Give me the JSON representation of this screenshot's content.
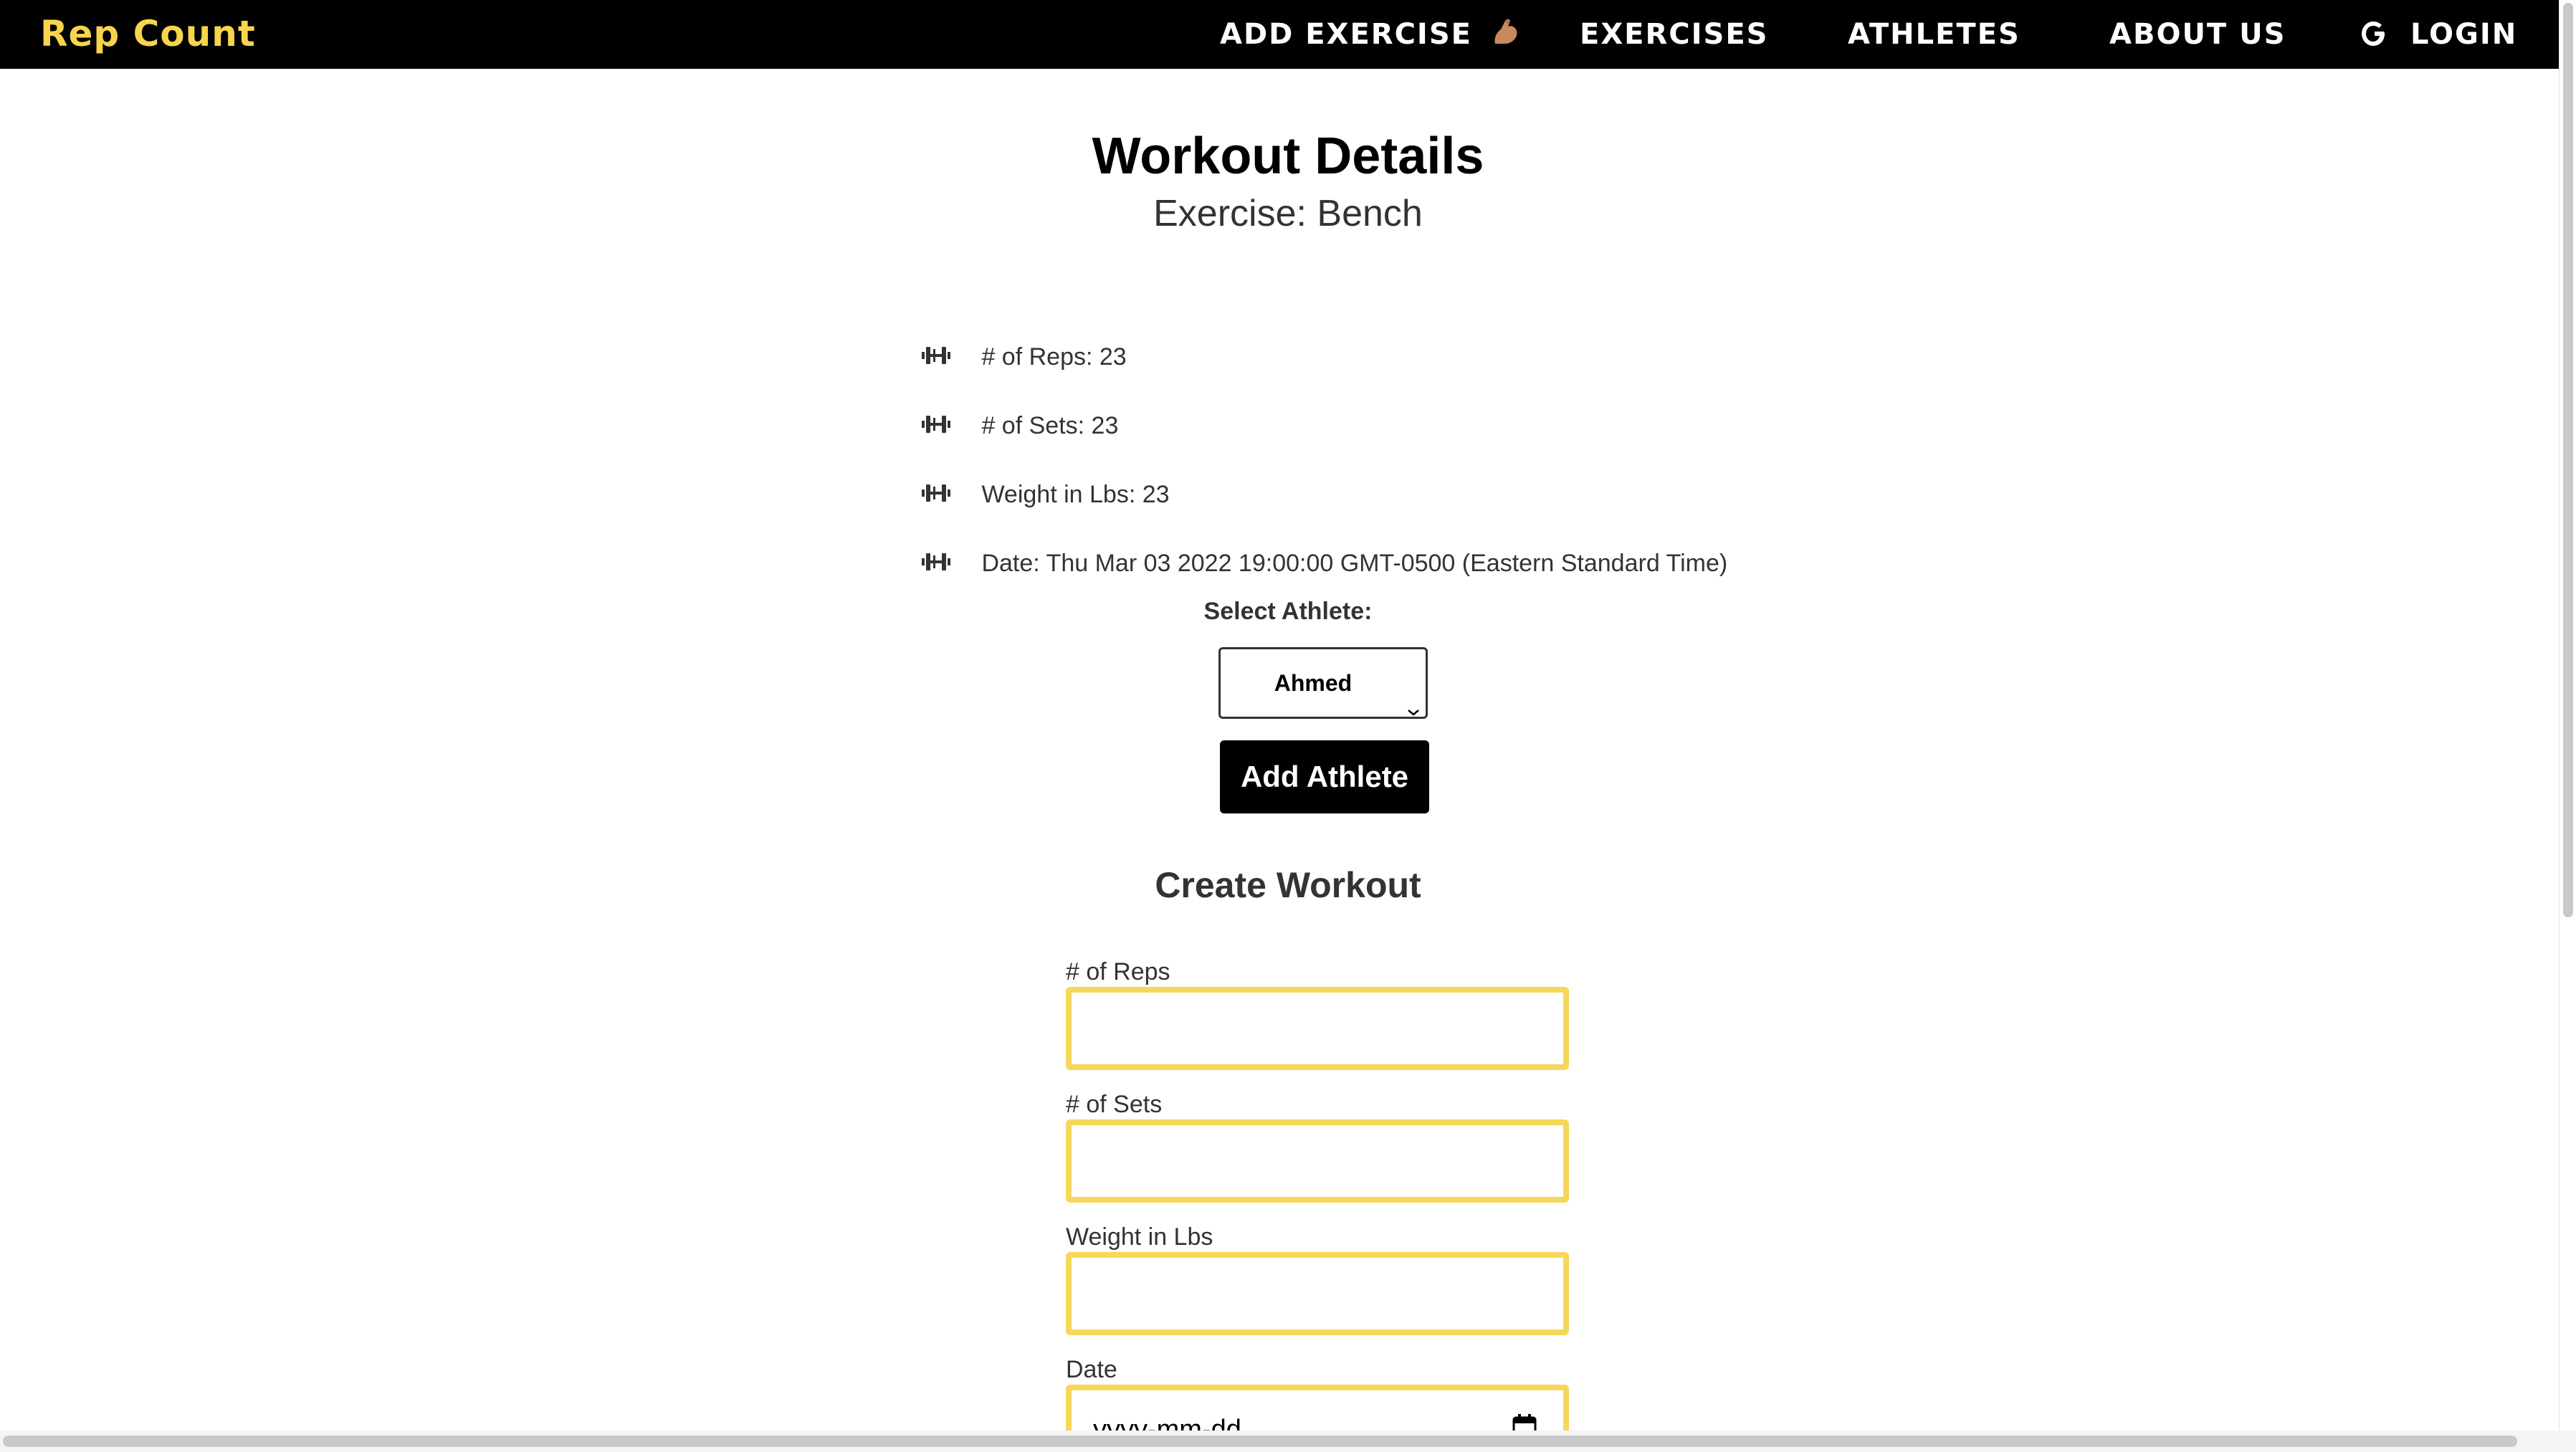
{
  "navbar": {
    "brand": "Rep Count",
    "items": [
      {
        "label": "ADD EXERCISE",
        "icon": "flexed-biceps-icon"
      },
      {
        "label": "EXERCISES"
      },
      {
        "label": "ATHLETES"
      },
      {
        "label": "ABOUT US"
      },
      {
        "label": "LOGIN",
        "icon": "google-icon"
      }
    ]
  },
  "workout": {
    "title": "Workout Details",
    "subtitle": "Exercise: Bench",
    "details": [
      "# of Reps: 23",
      "# of Sets: 23",
      "Weight in Lbs: 23",
      "Date: Thu Mar 03 2022 19:00:00 GMT-0500 (Eastern Standard Time)"
    ]
  },
  "athlete": {
    "label": "Select Athlete:",
    "selected": "Ahmed",
    "button": "Add Athlete"
  },
  "form": {
    "title": "Create Workout",
    "fields": [
      {
        "label": "# of Reps",
        "value": ""
      },
      {
        "label": "# of Sets",
        "value": ""
      },
      {
        "label": "Weight in Lbs",
        "value": ""
      },
      {
        "label": "Date",
        "placeholder": "yyyy-mm-dd"
      }
    ]
  },
  "colors": {
    "navbar_bg": "#000000",
    "brand": "#f7d44c",
    "input_border": "#f5d75a",
    "button_bg": "#000000"
  }
}
